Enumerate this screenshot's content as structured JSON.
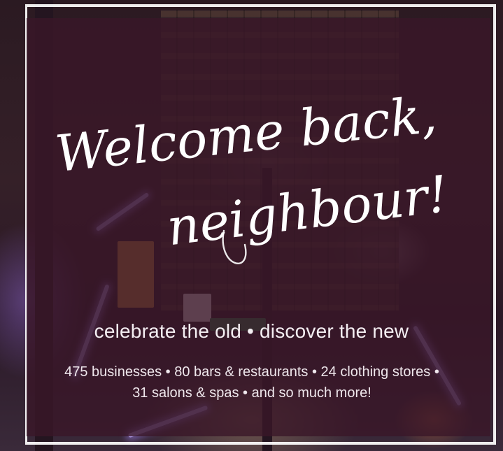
{
  "headline": {
    "line1": "Welcome back,",
    "line2": "neighbour!"
  },
  "tagline": "celebrate the old • discover the new",
  "stats": "475 businesses • 80 bars & restaurants • 24 clothing stores • 31 salons & spas • and so much more!",
  "colors": {
    "panel": "#3a1628",
    "text": "#f4eef2",
    "frame": "#ffffff"
  }
}
